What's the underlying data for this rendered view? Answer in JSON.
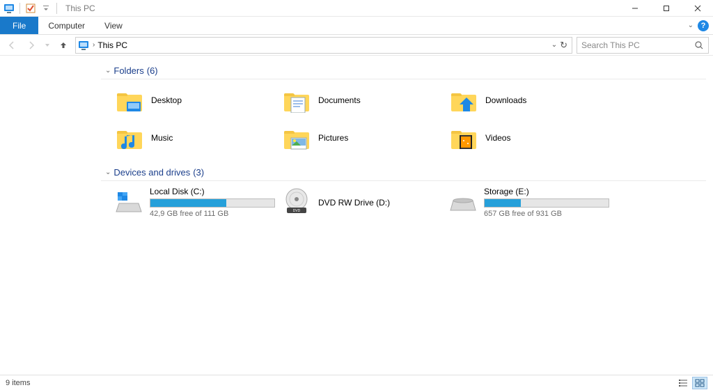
{
  "window": {
    "title": "This PC"
  },
  "tabs": {
    "file": "File",
    "computer": "Computer",
    "view": "View"
  },
  "address": {
    "location": "This PC"
  },
  "search": {
    "placeholder": "Search This PC"
  },
  "sections": {
    "folders": {
      "label": "Folders",
      "count": "(6)"
    },
    "drives": {
      "label": "Devices and drives",
      "count": "(3)"
    }
  },
  "folders": [
    {
      "name": "Desktop"
    },
    {
      "name": "Documents"
    },
    {
      "name": "Downloads"
    },
    {
      "name": "Music"
    },
    {
      "name": "Pictures"
    },
    {
      "name": "Videos"
    }
  ],
  "drives": [
    {
      "name": "Local Disk (C:)",
      "free": "42,9 GB free of 111 GB",
      "fill_pct": 61,
      "has_bar": true,
      "icon": "win-drive"
    },
    {
      "name": "DVD RW Drive (D:)",
      "free": "",
      "fill_pct": 0,
      "has_bar": false,
      "icon": "dvd-drive"
    },
    {
      "name": "Storage (E:)",
      "free": "657 GB free of 931 GB",
      "fill_pct": 29,
      "has_bar": true,
      "icon": "hdd-drive"
    }
  ],
  "status": {
    "items": "9 items"
  }
}
